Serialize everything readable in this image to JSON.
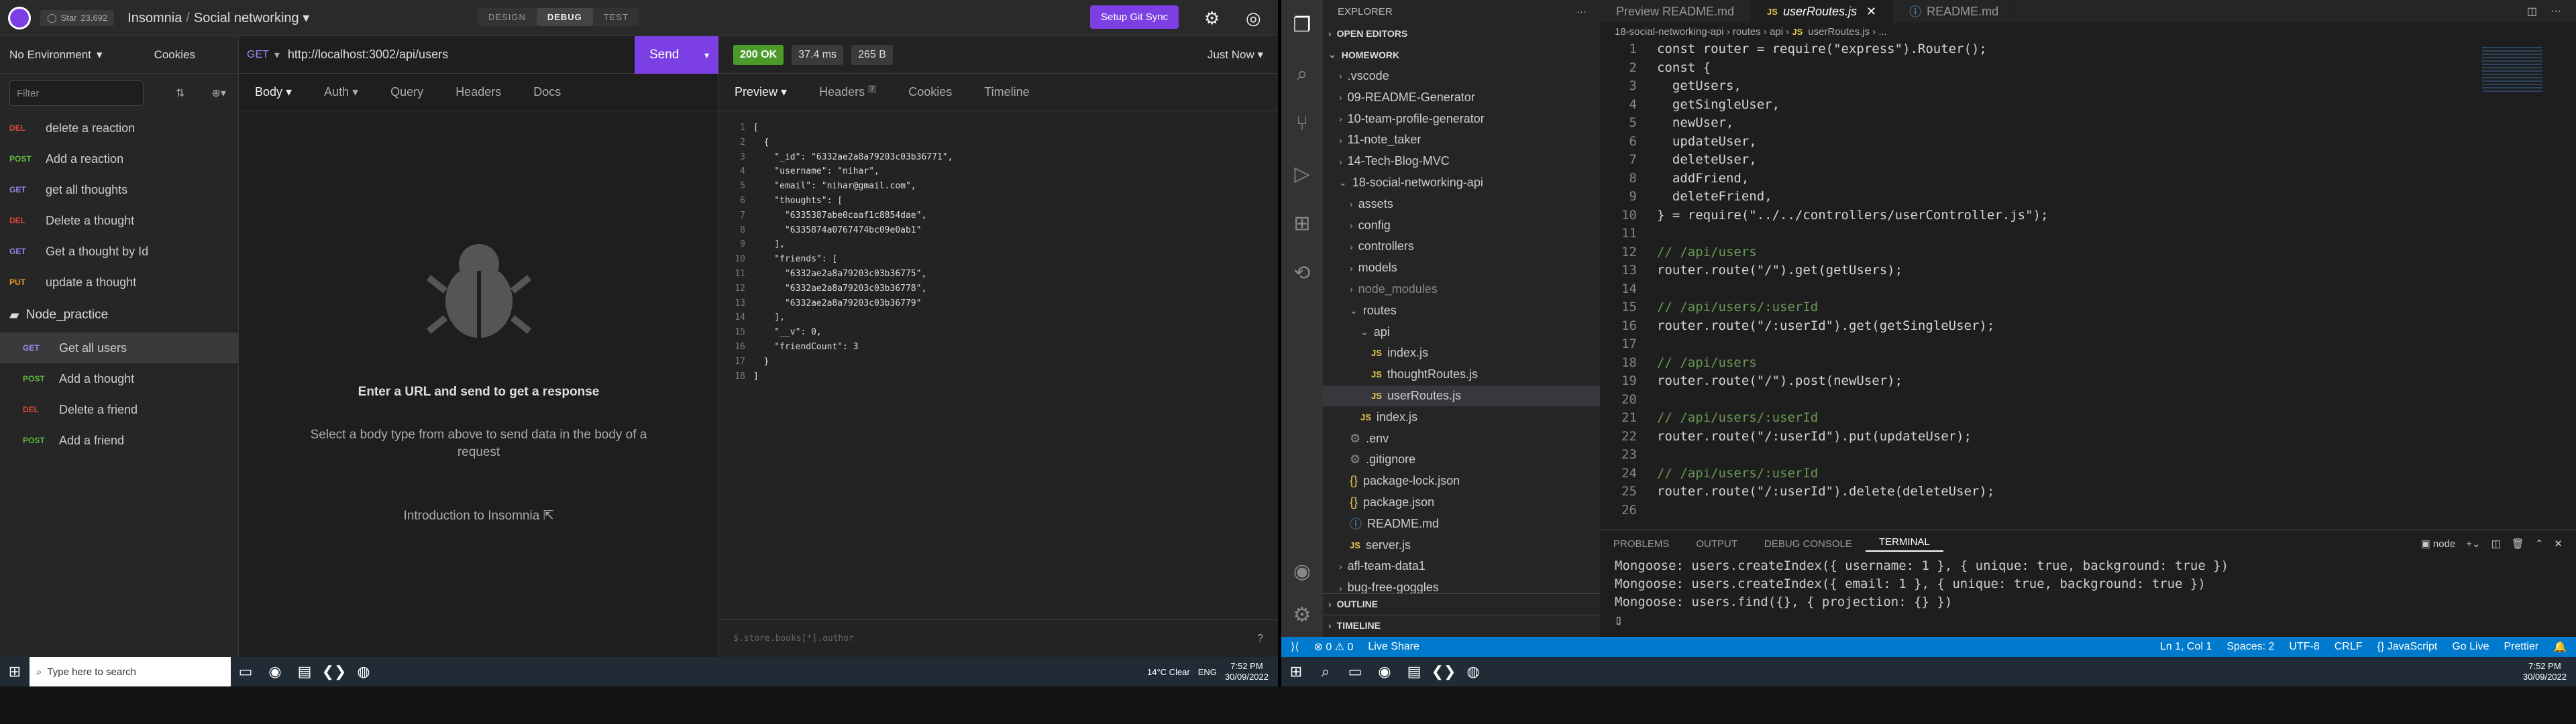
{
  "insomnia": {
    "github_label": "Star",
    "github_count": "23,692",
    "breadcrumb_app": "Insomnia",
    "breadcrumb_project": "Social networking",
    "modes": [
      "DESIGN",
      "DEBUG",
      "TEST"
    ],
    "sync_button": "Setup Git Sync",
    "env": "No Environment",
    "cookies": "Cookies",
    "filter_placeholder": "Filter",
    "requests": [
      {
        "method": "DEL",
        "label": "delete a reaction",
        "cls": "del"
      },
      {
        "method": "POST",
        "label": "Add a reaction",
        "cls": "post"
      },
      {
        "method": "GET",
        "label": "get all thoughts",
        "cls": "get"
      },
      {
        "method": "DEL",
        "label": "Delete a thought",
        "cls": "del"
      },
      {
        "method": "GET",
        "label": "Get a thought by Id",
        "cls": "get"
      },
      {
        "method": "PUT",
        "label": "update a thought",
        "cls": "put"
      }
    ],
    "folder": "Node_practice",
    "folder_requests": [
      {
        "method": "GET",
        "label": "Get all users",
        "cls": "get"
      },
      {
        "method": "POST",
        "label": "Add a thought",
        "cls": "post"
      },
      {
        "method": "DEL",
        "label": "Delete a friend",
        "cls": "del"
      },
      {
        "method": "POST",
        "label": "Add a friend",
        "cls": "post"
      }
    ],
    "url_method": "GET",
    "url": "http://localhost:3002/api/users",
    "send": "Send",
    "req_tabs": [
      "Body",
      "Auth",
      "Query",
      "Headers",
      "Docs"
    ],
    "empty_title": "Enter a URL and send to get a response",
    "empty_sub": "Select a body type from above to send data in the body of a request",
    "intro_link": "Introduction to Insomnia",
    "status": "200 OK",
    "time": "37.4 ms",
    "size": "265 B",
    "when": "Just Now",
    "resp_tabs": [
      "Preview",
      "Headers",
      "Cookies",
      "Timeline"
    ],
    "headers_count": "7",
    "filter_hint": "$.store.books[*].author",
    "response_lines": [
      "[",
      "  {",
      "    \"_id\": \"6332ae2a8a79203c03b36771\",",
      "    \"username\": \"nihar\",",
      "    \"email\": \"nihar@gmail.com\",",
      "    \"thoughts\": [",
      "      \"6335387abe0caaf1c8854dae\",",
      "      \"6335874a0767474bc09e0ab1\"",
      "    ],",
      "    \"friends\": [",
      "      \"6332ae2a8a79203c03b36775\",",
      "      \"6332ae2a8a79203c03b36778\",",
      "      \"6332ae2a8a79203c03b36779\"",
      "    ],",
      "    \"__v\": 0,",
      "    \"friendCount\": 3",
      "  }",
      "]"
    ]
  },
  "vscode": {
    "explorer_title": "EXPLORER",
    "open_editors": "OPEN EDITORS",
    "workspace": "HOMEWORK",
    "tree": [
      {
        "t": ".vscode",
        "d": 1,
        "k": "folder"
      },
      {
        "t": "09-README-Generator",
        "d": 1,
        "k": "folder"
      },
      {
        "t": "10-team-profile-generator",
        "d": 1,
        "k": "folder"
      },
      {
        "t": "11-note_taker",
        "d": 1,
        "k": "folder"
      },
      {
        "t": "14-Tech-Blog-MVC",
        "d": 1,
        "k": "folder"
      },
      {
        "t": "18-social-networking-api",
        "d": 1,
        "k": "open"
      },
      {
        "t": "assets",
        "d": 2,
        "k": "folder"
      },
      {
        "t": "config",
        "d": 2,
        "k": "folder"
      },
      {
        "t": "controllers",
        "d": 2,
        "k": "folder"
      },
      {
        "t": "models",
        "d": 2,
        "k": "folder"
      },
      {
        "t": "node_modules",
        "d": 2,
        "k": "folder"
      },
      {
        "t": "routes",
        "d": 2,
        "k": "open"
      },
      {
        "t": "api",
        "d": 3,
        "k": "open"
      },
      {
        "t": "index.js",
        "d": 4,
        "k": "js"
      },
      {
        "t": "thoughtRoutes.js",
        "d": 4,
        "k": "js"
      },
      {
        "t": "userRoutes.js",
        "d": 4,
        "k": "js"
      },
      {
        "t": "index.js",
        "d": 3,
        "k": "js"
      },
      {
        "t": ".env",
        "d": 2,
        "k": "file"
      },
      {
        "t": ".gitignore",
        "d": 2,
        "k": "file"
      },
      {
        "t": "package-lock.json",
        "d": 2,
        "k": "json"
      },
      {
        "t": "package.json",
        "d": 2,
        "k": "json"
      },
      {
        "t": "README.md",
        "d": 2,
        "k": "md"
      },
      {
        "t": "server.js",
        "d": 2,
        "k": "js"
      },
      {
        "t": "afl-team-data1",
        "d": 1,
        "k": "folder"
      },
      {
        "t": "bug-free-goggles",
        "d": 1,
        "k": "folder"
      }
    ],
    "outline": "OUTLINE",
    "timeline": "TIMELINE",
    "tabs": [
      "Preview README.md",
      "userRoutes.js",
      "README.md"
    ],
    "breadcrumb": [
      "18-social-networking-api",
      "routes",
      "api",
      "userRoutes.js",
      "..."
    ],
    "code": [
      "const router = require(\"express\").Router();",
      "const {",
      "  getUsers,",
      "  getSingleUser,",
      "  newUser,",
      "  updateUser,",
      "  deleteUser,",
      "  addFriend,",
      "  deleteFriend,",
      "} = require(\"../../controllers/userController.js\");",
      "",
      "// /api/users",
      "router.route(\"/\").get(getUsers);",
      "",
      "// /api/users/:userId",
      "router.route(\"/:userId\").get(getSingleUser);",
      "",
      "// /api/users",
      "router.route(\"/\").post(newUser);",
      "",
      "// /api/users/:userId",
      "router.route(\"/:userId\").put(updateUser);",
      "",
      "// /api/users/:userId",
      "router.route(\"/:userId\").delete(deleteUser);",
      ""
    ],
    "panel_tabs": [
      "PROBLEMS",
      "OUTPUT",
      "DEBUG CONSOLE",
      "TERMINAL"
    ],
    "terminal_shell": "node",
    "terminal": [
      "Mongoose: users.createIndex({ username: 1 }, { unique: true, background: true })",
      "Mongoose: users.createIndex({ email: 1 }, { unique: true, background: true })",
      "Mongoose: users.find({}, { projection: {} })"
    ],
    "status": {
      "errors": "0",
      "warnings": "0",
      "live": "Live Share",
      "pos": "Ln 1, Col 1",
      "spaces": "Spaces: 2",
      "enc": "UTF-8",
      "eol": "CRLF",
      "lang": "JavaScript",
      "golive": "Go Live",
      "prettier": "Prettier"
    }
  },
  "taskbar": {
    "search": "Type here to search",
    "weather": "14°C  Clear",
    "lang": "ENG",
    "time": "7:52 PM",
    "date": "30/09/2022"
  }
}
